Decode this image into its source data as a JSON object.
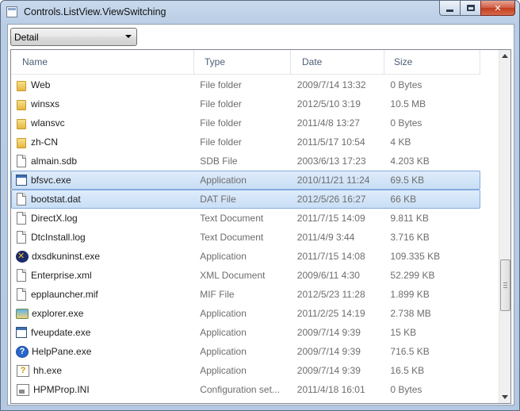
{
  "window": {
    "title": "Controls.ListView.ViewSwitching",
    "minimize_icon": "minimize-icon",
    "maximize_icon": "maximize-icon",
    "close_glyph": "✕"
  },
  "view_selector": {
    "selected": "Detail"
  },
  "columns": {
    "name": "Name",
    "type": "Type",
    "date": "Date",
    "size": "Size"
  },
  "rows": [
    {
      "name": "Web",
      "type": "File folder",
      "date": "2009/7/14 13:32",
      "size": "0 Bytes",
      "icon": "folder-icon"
    },
    {
      "name": "winsxs",
      "type": "File folder",
      "date": "2012/5/10 3:19",
      "size": "10.5 MB",
      "icon": "folder-icon"
    },
    {
      "name": "wlansvc",
      "type": "File folder",
      "date": "2011/4/8 13:27",
      "size": "0 Bytes",
      "icon": "folder-icon"
    },
    {
      "name": "zh-CN",
      "type": "File folder",
      "date": "2011/5/17 10:54",
      "size": "4 KB",
      "icon": "folder-icon"
    },
    {
      "name": "almain.sdb",
      "type": "SDB File",
      "date": "2003/6/13 17:23",
      "size": "4.203 KB",
      "icon": "file-icon"
    },
    {
      "name": "bfsvc.exe",
      "type": "Application",
      "date": "2010/11/21 11:24",
      "size": "69.5 KB",
      "icon": "application-icon",
      "selected": true
    },
    {
      "name": "bootstat.dat",
      "type": "DAT File",
      "date": "2012/5/26 16:27",
      "size": "66 KB",
      "icon": "file-icon",
      "selected": true
    },
    {
      "name": "DirectX.log",
      "type": "Text Document",
      "date": "2011/7/15 14:09",
      "size": "9.811 KB",
      "icon": "file-icon"
    },
    {
      "name": "DtcInstall.log",
      "type": "Text Document",
      "date": "2011/4/9 3:44",
      "size": "3.716 KB",
      "icon": "file-icon"
    },
    {
      "name": "dxsdkuninst.exe",
      "type": "Application",
      "date": "2011/7/15 14:08",
      "size": "109.335 KB",
      "icon": "setup-icon"
    },
    {
      "name": "Enterprise.xml",
      "type": "XML Document",
      "date": "2009/6/11 4:30",
      "size": "52.299 KB",
      "icon": "file-icon"
    },
    {
      "name": "epplauncher.mif",
      "type": "MIF File",
      "date": "2012/5/23 11:28",
      "size": "1.899 KB",
      "icon": "file-icon"
    },
    {
      "name": "explorer.exe",
      "type": "Application",
      "date": "2011/2/25 14:19",
      "size": "2.738 MB",
      "icon": "explorer-icon"
    },
    {
      "name": "fveupdate.exe",
      "type": "Application",
      "date": "2009/7/14 9:39",
      "size": "15 KB",
      "icon": "application-icon"
    },
    {
      "name": "HelpPane.exe",
      "type": "Application",
      "date": "2009/7/14 9:39",
      "size": "716.5 KB",
      "icon": "help-icon"
    },
    {
      "name": "hh.exe",
      "type": "Application",
      "date": "2009/7/14 9:39",
      "size": "16.5 KB",
      "icon": "help-file-icon"
    },
    {
      "name": "HPMProp.INI",
      "type": "Configuration set...",
      "date": "2011/4/18 16:01",
      "size": "0 Bytes",
      "icon": "config-file-icon"
    }
  ]
}
